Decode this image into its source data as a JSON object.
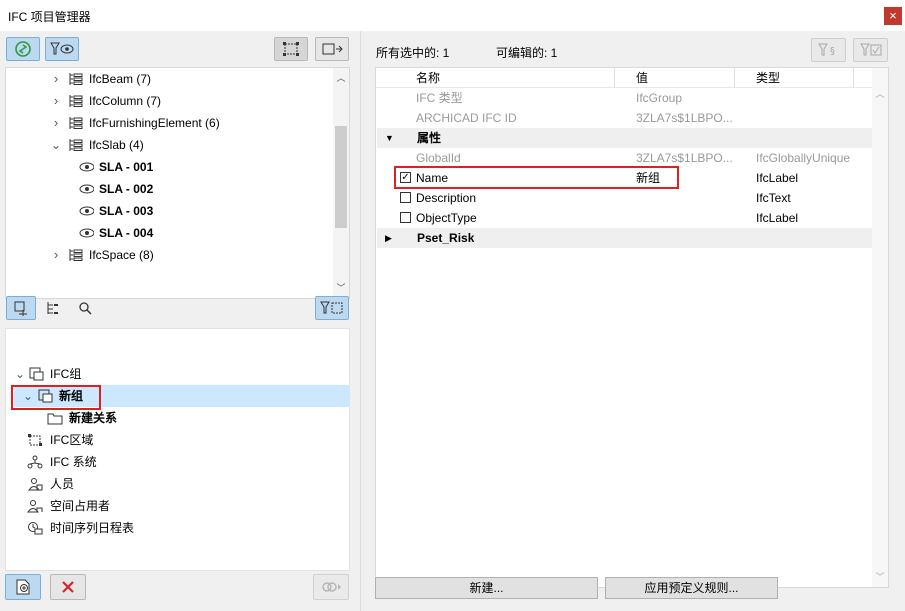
{
  "window": {
    "title": "IFC 项目管理器",
    "close_glyph": "×"
  },
  "left_toolbar": {
    "refresh_icon": "refresh-icon",
    "filter_view_icon": "filter-eye-icon",
    "select_element_icon": "select-element-icon",
    "select_arrow_icon": "select-arrow-icon"
  },
  "top_tree": {
    "items": [
      {
        "label": "IfcBeam (7)",
        "expanded": false,
        "level": 1
      },
      {
        "label": "IfcColumn (7)",
        "expanded": false,
        "level": 1
      },
      {
        "label": "IfcFurnishingElement (6)",
        "expanded": false,
        "level": 1
      },
      {
        "label": "IfcSlab (4)",
        "expanded": true,
        "level": 1
      },
      {
        "label": "SLA - 001",
        "level": 2
      },
      {
        "label": "SLA - 002",
        "level": 2
      },
      {
        "label": "SLA - 003",
        "level": 2
      },
      {
        "label": "SLA - 004",
        "level": 2
      },
      {
        "label": "IfcSpace (8)",
        "expanded": false,
        "level": 1
      }
    ]
  },
  "mid_toolbar": {
    "group_tab_icon": "group-icon",
    "hierarchy_tab_icon": "hierarchy-icon",
    "search_tab_icon": "search-icon",
    "filter_select_icon": "filter-select-icon"
  },
  "bottom_tree": {
    "items": [
      {
        "label": "IFC组",
        "expanded": true
      },
      {
        "label": "新组",
        "expanded": true,
        "selected": true
      },
      {
        "label": "新建关系"
      },
      {
        "label": "IFC区域"
      },
      {
        "label": "IFC 系统"
      },
      {
        "label": "人员"
      },
      {
        "label": "空间占用者"
      },
      {
        "label": "时间序列日程表"
      }
    ]
  },
  "left_footer": {
    "new_icon": "new-document-icon",
    "delete_icon": "delete-icon",
    "link_icon": "link-icon"
  },
  "right_header": {
    "all_selected_label": "所有选中的: 1",
    "editable_label": "可编辑的: 1",
    "filter_attr_icon": "filter-attribute-icon",
    "filter_check_icon": "filter-checked-icon"
  },
  "property_table": {
    "columns": [
      "名称",
      "值",
      "类型"
    ],
    "rows": [
      {
        "kind": "info",
        "name": "IFC 类型",
        "value": "IfcGroup",
        "type": ""
      },
      {
        "kind": "info",
        "name": "ARCHICAD IFC ID",
        "value": "3ZLA7s$1LBPO...",
        "type": ""
      },
      {
        "kind": "section",
        "name": "属性",
        "expanded": true
      },
      {
        "kind": "info",
        "name": "GlobalId",
        "value": "3ZLA7s$1LBPO...",
        "type": "IfcGloballyUnique"
      },
      {
        "kind": "prop",
        "checked": true,
        "name": "Name",
        "value": "新组",
        "type": "IfcLabel"
      },
      {
        "kind": "prop",
        "checked": false,
        "name": "Description",
        "value": "",
        "type": "IfcText"
      },
      {
        "kind": "prop",
        "checked": false,
        "name": "ObjectType",
        "value": "",
        "type": "IfcLabel"
      },
      {
        "kind": "section",
        "name": "Pset_Risk",
        "expanded": false
      }
    ]
  },
  "right_footer": {
    "new_button": "新建...",
    "apply_rules_button": "应用预定义规则..."
  },
  "colors": {
    "selection": "#cce8ff",
    "highlight_box": "#e02020",
    "accent_green": "#2e9a3e",
    "delete_red": "#d9252a"
  }
}
